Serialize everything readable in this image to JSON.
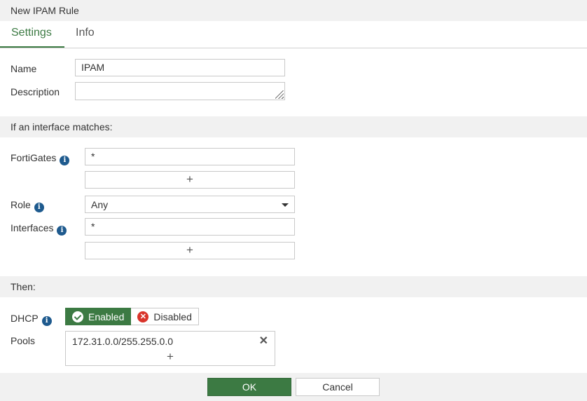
{
  "dialog": {
    "title": "New IPAM Rule"
  },
  "tabs": [
    {
      "label": "Settings"
    },
    {
      "label": "Info"
    }
  ],
  "settings": {
    "name_label": "Name",
    "name_value": "IPAM",
    "description_label": "Description",
    "description_value": ""
  },
  "match_section": {
    "heading": "If an interface matches:",
    "fortigates_label": "FortiGates",
    "fortigates_value": "*",
    "role_label": "Role",
    "role_value": "Any",
    "interfaces_label": "Interfaces",
    "interfaces_value": "*",
    "add_glyph": "+"
  },
  "then_section": {
    "heading": "Then:",
    "dhcp_label": "DHCP",
    "dhcp_enabled": "Enabled",
    "dhcp_disabled": "Disabled",
    "dhcp_state": "Enabled",
    "pools_label": "Pools",
    "pools": [
      "172.31.0.0/255.255.0.0"
    ],
    "remove_glyph": "✕",
    "add_glyph": "+"
  },
  "footer": {
    "ok_label": "OK",
    "cancel_label": "Cancel"
  },
  "colors": {
    "accent": "#3c7a43",
    "info_icon": "#1e5a8e",
    "disabled_icon": "#d9342b"
  },
  "icons": {
    "info": "info-icon",
    "check": "check-circle-icon",
    "x": "x-circle-icon",
    "caret": "caret-down-icon"
  }
}
